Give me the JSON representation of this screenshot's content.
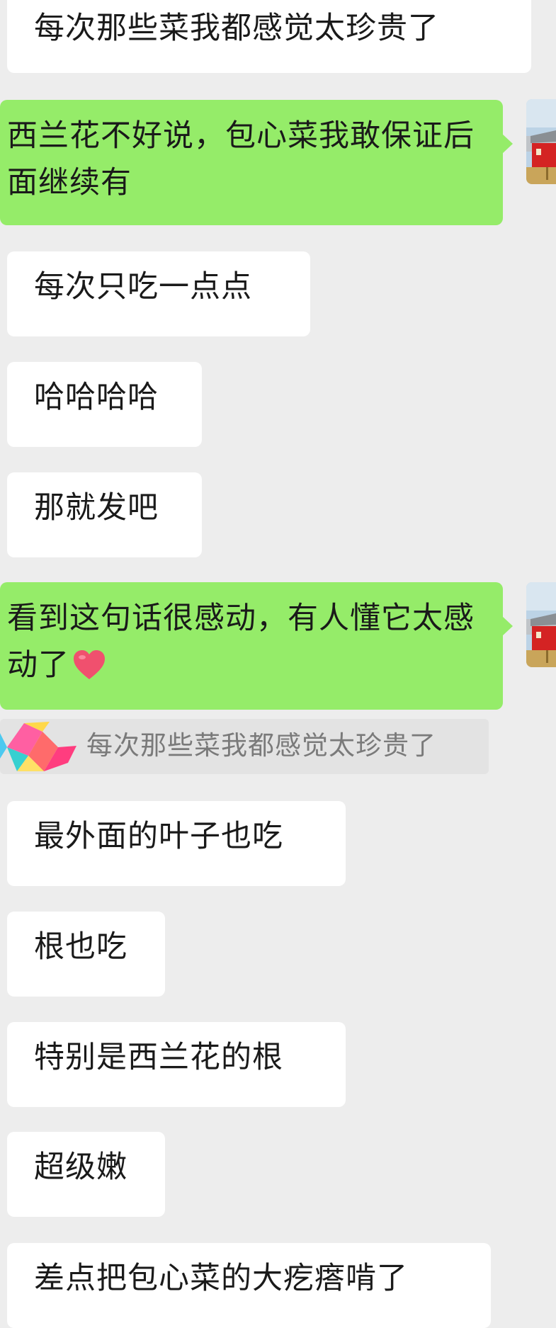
{
  "messages": [
    {
      "side": "incoming",
      "text": "每次那些菜我都感觉太珍贵了"
    },
    {
      "side": "outgoing",
      "text": "西兰花不好说，包心菜我敢保证后面继续有"
    },
    {
      "side": "incoming",
      "text": "每次只吃一点点"
    },
    {
      "side": "incoming",
      "text": "哈哈哈哈"
    },
    {
      "side": "incoming",
      "text": "那就发吧"
    },
    {
      "side": "outgoing",
      "text": "看到这句话很感动，有人懂它太感动了",
      "emoji": "heart-emoji"
    },
    {
      "side": "incoming",
      "text": "最外面的叶子也吃"
    },
    {
      "side": "incoming",
      "text": "根也吃"
    },
    {
      "side": "incoming",
      "text": "特别是西兰花的根"
    },
    {
      "side": "incoming",
      "text": "超级嫩"
    },
    {
      "side": "incoming",
      "text": "差点把包心菜的大疙瘩啃了"
    }
  ],
  "quoted_reply": {
    "text": "每次那些菜我都感觉太珍贵了"
  },
  "colors": {
    "background": "#ededed",
    "incoming_bubble": "#ffffff",
    "outgoing_bubble": "#95ec69",
    "quote_background": "#e3e3e3",
    "quote_text": "#7a7a7a",
    "heart": "#f0506e"
  },
  "icons": {
    "my_avatar": "red-barn-avatar",
    "quote_avatar": "colorful-shapes-avatar"
  }
}
